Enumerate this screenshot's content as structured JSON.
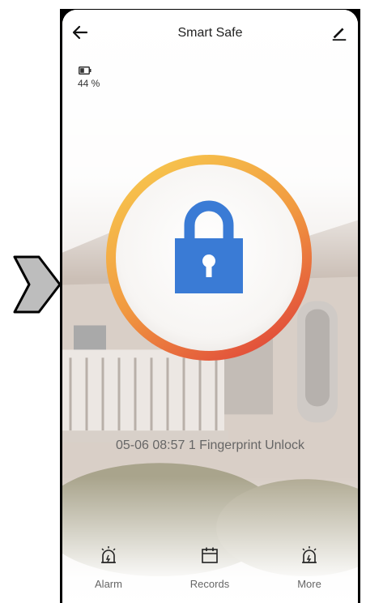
{
  "header": {
    "title": "Smart Safe"
  },
  "battery": {
    "level_text": "44 %",
    "level": 0.44
  },
  "lock": {
    "state": "locked",
    "ring_colors": [
      "#f6c453",
      "#f29a3c",
      "#e2533b"
    ],
    "lock_color": "#3a7bd5"
  },
  "status": {
    "last_record": "05-06 08:57  1 Fingerprint Unlock"
  },
  "bottom_nav": {
    "items": [
      {
        "label": "Alarm",
        "icon": "alarm-icon"
      },
      {
        "label": "Records",
        "icon": "calendar-icon"
      },
      {
        "label": "More",
        "icon": "alarm-icon"
      }
    ]
  }
}
